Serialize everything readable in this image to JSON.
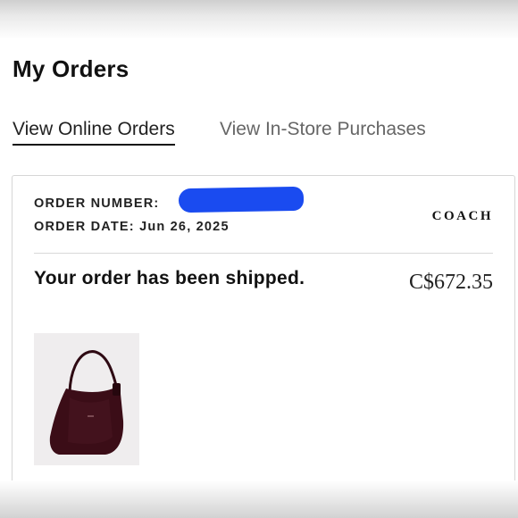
{
  "page": {
    "title": "My Orders"
  },
  "tabs": [
    {
      "label": "View Online Orders",
      "active": true
    },
    {
      "label": "View In-Store Purchases",
      "active": false
    }
  ],
  "order": {
    "number_label": "ORDER NUMBER:",
    "date_label": "ORDER DATE:",
    "date": "Jun 26, 2025",
    "brand": "COACH",
    "status": "Your order has been shipped.",
    "total": "C$672.35",
    "product_image": {
      "subject": "bag",
      "color": "#3b0d17"
    }
  },
  "colors": {
    "redaction": "#1a4bf0",
    "card_border": "#d6d6d6"
  }
}
